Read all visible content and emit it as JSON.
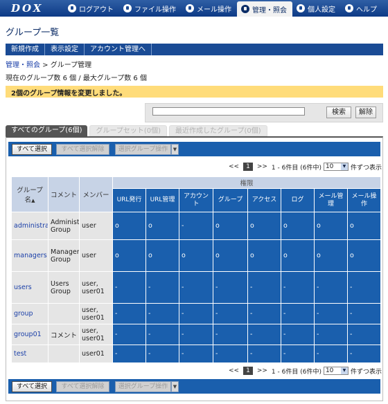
{
  "header": {
    "logo": "DOX",
    "nav": [
      {
        "label": "ログアウト",
        "icon": "logout-icon"
      },
      {
        "label": "ファイル操作",
        "icon": "file-icon"
      },
      {
        "label": "メール操作",
        "icon": "mail-icon"
      },
      {
        "label": "管理・照会",
        "icon": "admin-icon"
      },
      {
        "label": "個人設定",
        "icon": "user-icon"
      },
      {
        "label": "ヘルプ",
        "icon": "help-icon"
      }
    ]
  },
  "page": {
    "title": "グループ一覧",
    "menu": [
      "新規作成",
      "表示設定",
      "アカウント管理へ"
    ],
    "breadcrumb_link": "管理・照会",
    "breadcrumb_rest": " > グループ管理",
    "summary": "現在のグループ数 6 個 / 最大グループ数 6 個",
    "notice": "2個のグループ情報を変更しました。"
  },
  "search": {
    "value": "",
    "search_label": "検索",
    "clear_label": "解除"
  },
  "tabs": [
    "すべてのグループ(6個)",
    "グループセット(0個)",
    "最近作成したグループ(0個)"
  ],
  "actions": {
    "select_all": "すべて選択",
    "deselect_all": "すべて選択解除",
    "group_ops": "選択グループ操作"
  },
  "pager": {
    "prev": "<<",
    "current": "1",
    "next": ">>",
    "range": "1 - 6件目 (6件中)",
    "per_page": "10",
    "per_page_suffix": "件ずつ表示"
  },
  "table": {
    "headers": {
      "group_name": "グループ名",
      "comment": "コメント",
      "members": "メンバー",
      "permissions": "権限",
      "perm_cols": [
        "URL発行",
        "URL管理",
        "アカウント",
        "グループ",
        "アクセス",
        "ログ",
        "メール管理",
        "メール操作"
      ]
    },
    "rows": [
      {
        "name": "administrators",
        "comment": "Administrators Group",
        "members": "user",
        "perms": [
          "o",
          "o",
          "-",
          "o",
          "o",
          "o",
          "o",
          "o"
        ]
      },
      {
        "name": "managers",
        "comment": "Managers Group",
        "members": "user",
        "perms": [
          "o",
          "o",
          "o",
          "o",
          "o",
          "o",
          "o",
          "o"
        ]
      },
      {
        "name": "users",
        "comment": "Users Group",
        "members": "user, user01",
        "perms": [
          "-",
          "-",
          "-",
          "-",
          "-",
          "-",
          "-",
          "-"
        ]
      },
      {
        "name": "group",
        "comment": "",
        "members": "user, user01",
        "perms": [
          "-",
          "-",
          "-",
          "-",
          "-",
          "-",
          "-",
          "-"
        ]
      },
      {
        "name": "group01",
        "comment": "コメント",
        "members": "user, user01",
        "perms": [
          "-",
          "-",
          "-",
          "-",
          "-",
          "-",
          "-",
          "-"
        ]
      },
      {
        "name": "test",
        "comment": "",
        "members": "user01",
        "perms": [
          "-",
          "-",
          "-",
          "-",
          "-",
          "-",
          "-",
          "-"
        ]
      }
    ]
  }
}
